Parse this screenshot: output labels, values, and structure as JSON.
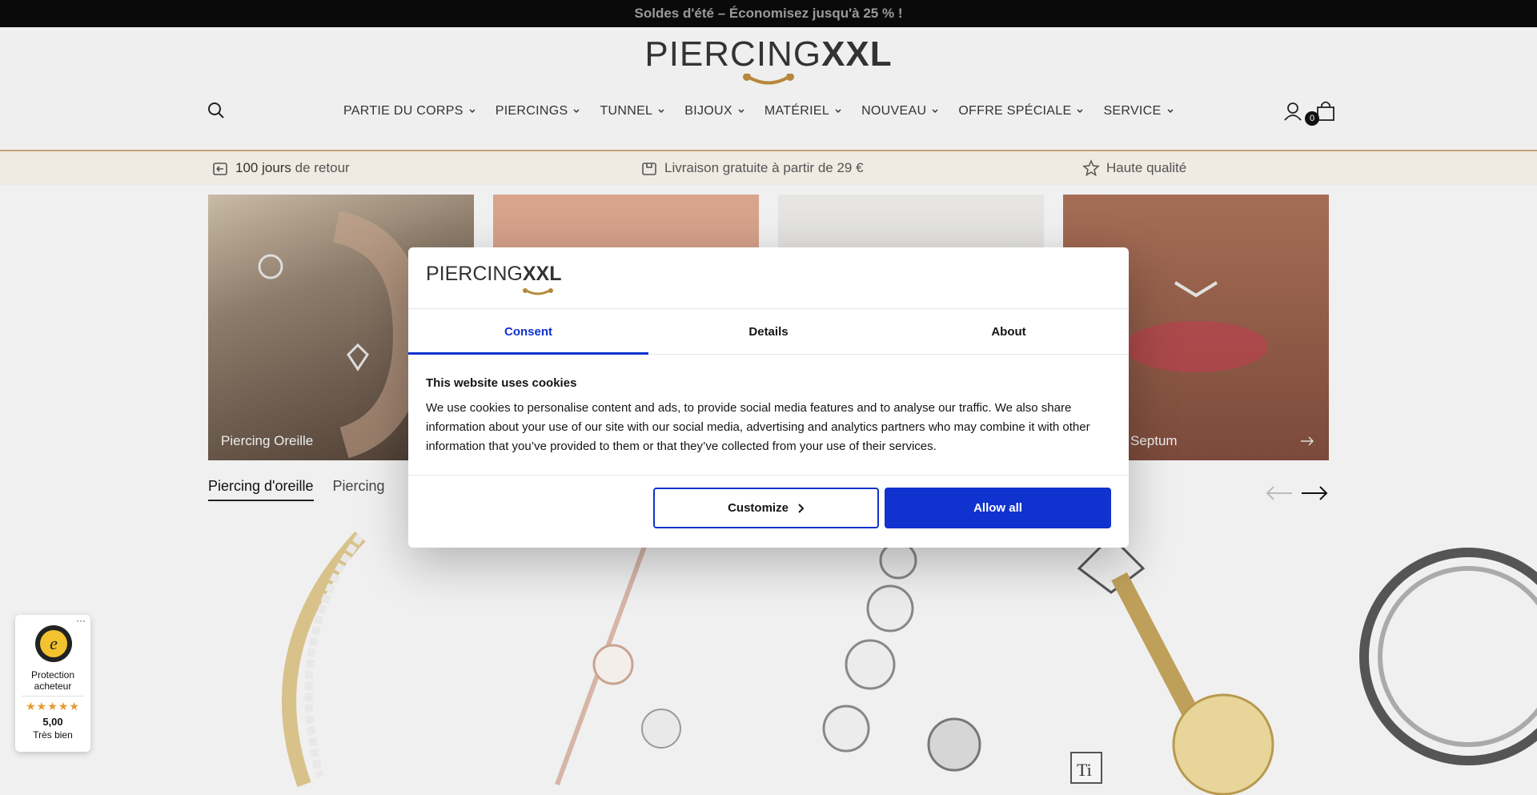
{
  "promo": {
    "text": "Soldes d'été – Économisez jusqu'à 25 % !"
  },
  "header": {
    "logo": {
      "left": "PIERCING",
      "right": "XXL"
    },
    "nav": [
      {
        "label": "PARTIE DU CORPS"
      },
      {
        "label": "PIERCINGS"
      },
      {
        "label": "TUNNEL"
      },
      {
        "label": "BIJOUX"
      },
      {
        "label": "MATÉRIEL"
      },
      {
        "label": "NOUVEAU"
      },
      {
        "label": "OFFRE SPÉCIALE"
      },
      {
        "label": "SERVICE"
      }
    ],
    "cart_count": "0"
  },
  "usps": [
    {
      "bold": "100 jours",
      "rest": " de retour",
      "icon": "return-box-icon"
    },
    {
      "bold": "",
      "rest": "Livraison gratuite à partir de 29 €",
      "icon": "delivery-box-icon"
    },
    {
      "bold": "",
      "rest": "Haute qualité",
      "icon": "star-icon"
    }
  ],
  "categories": [
    {
      "label": "Piercing Oreille"
    },
    {
      "label": ""
    },
    {
      "label": ""
    },
    {
      "label": "Septum"
    }
  ],
  "product_tabs": [
    {
      "label": "Piercing d'oreille"
    },
    {
      "label": "Piercing"
    }
  ],
  "cookie_modal": {
    "logo": {
      "left": "PIERCING",
      "right": "XXL"
    },
    "tabs": [
      {
        "label": "Consent"
      },
      {
        "label": "Details"
      },
      {
        "label": "About"
      }
    ],
    "title": "This website uses cookies",
    "body": "We use cookies to personalise content and ads, to provide social media features and to analyse our traffic. We also share information about your use of our site with our social media, advertising and analytics partners who may combine it with other information that you’ve provided to them or that they’ve collected from your use of their services.",
    "customize_label": "Customize",
    "allow_label": "Allow all",
    "accent": "#1032cf"
  },
  "trust_badge": {
    "more": "···",
    "line1": "Protection acheteur",
    "stars": "★★★★★",
    "score": "5,00",
    "rating": "Très bien"
  }
}
